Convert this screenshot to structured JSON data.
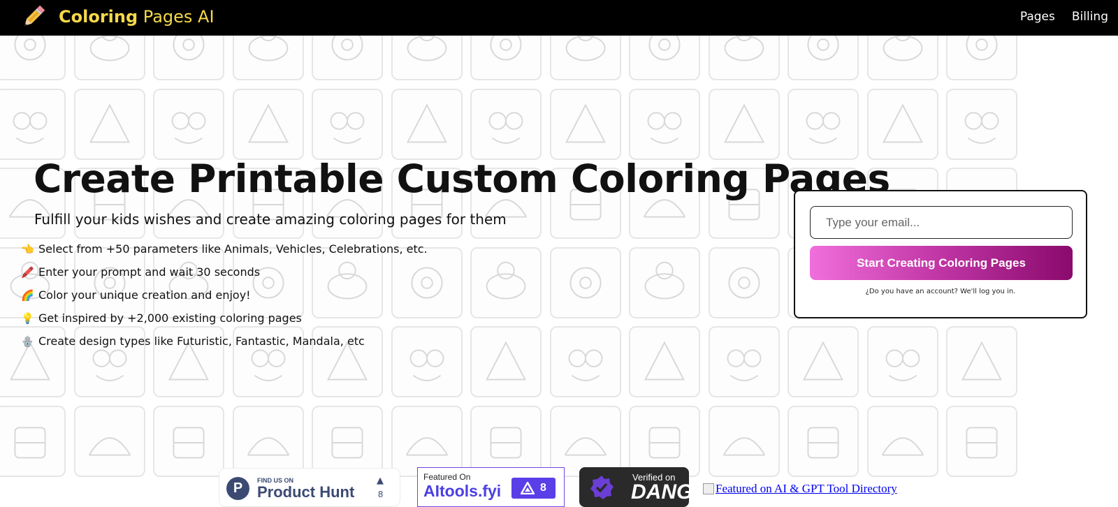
{
  "header": {
    "logo_icon": "pencil-icon",
    "brand_bold": "Coloring",
    "brand_light": "Pages AI",
    "nav": [
      {
        "label": "Pages"
      },
      {
        "label": "Billing"
      }
    ],
    "brand_color": "#f5d949"
  },
  "hero": {
    "title": "Create Printable Custom Coloring Pages",
    "subtitle": "Fulfill your kids wishes and create amazing coloring pages for them",
    "features": [
      {
        "icon": "pointing-hand-icon",
        "emoji": "👈",
        "text": "Select from +50 parameters like Animals, Vehicles, Celebrations, etc."
      },
      {
        "icon": "crayon-icon",
        "emoji": "🖍️",
        "text": "Enter your prompt and wait 30 seconds"
      },
      {
        "icon": "rainbow-icon",
        "emoji": "🌈",
        "text": "Color your unique creation and enjoy!"
      },
      {
        "icon": "lightbulb-icon",
        "emoji": "💡",
        "text": "Get inspired by +2,000 existing coloring pages"
      },
      {
        "icon": "ornament-icon",
        "emoji": "🪬",
        "text": "Create design types like Futuristic, Fantastic, Mandala, etc"
      }
    ]
  },
  "signup": {
    "email_placeholder": "Type your email...",
    "cta_label": "Start Creating Coloring Pages",
    "hint": "¿Do you have an account? We'll log you in.",
    "cta_gradient": [
      "#f06fdc",
      "#c43aa9",
      "#8a0a6d"
    ]
  },
  "badges": {
    "product_hunt": {
      "small": "FIND US ON",
      "big": "Product Hunt",
      "count": "8",
      "letter": "P"
    },
    "aitools": {
      "featured": "Featured On",
      "name": "AItools.fyi",
      "count": "8"
    },
    "dang": {
      "verified": "Verified on",
      "name": "DANG!"
    },
    "gpt_directory": {
      "link_text": "Featured on AI & GPT Tool Directory"
    }
  }
}
